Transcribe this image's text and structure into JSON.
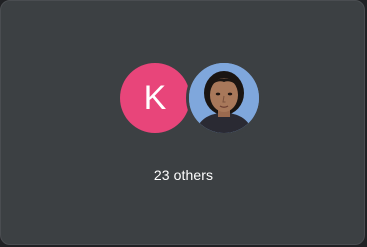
{
  "tile": {
    "background": "#3c4043",
    "avatars": [
      {
        "type": "initial",
        "letter": "K",
        "color": "#e8457a"
      },
      {
        "type": "photo",
        "icon": "participant-photo",
        "color": "#7fa7dc"
      }
    ],
    "others_label": "23 others"
  }
}
